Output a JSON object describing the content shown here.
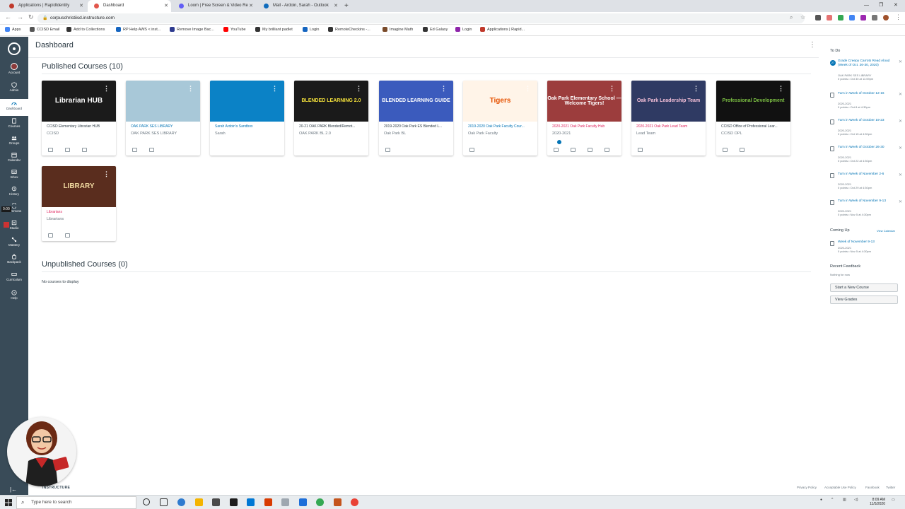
{
  "browser": {
    "tabs": [
      {
        "label": "Applications | RapidIdentity",
        "color": "#c0392b"
      },
      {
        "label": "Dashboard",
        "color": "#e2574c"
      },
      {
        "label": "Loom | Free Screen & Video Re",
        "color": "#625df5"
      },
      {
        "label": "Mail - Ardoin, Sarah - Outlook",
        "color": "#0f6cbd"
      }
    ],
    "new_tab_label": "+",
    "url": "corpuschristiisd.instructure.com",
    "bookmarks": [
      {
        "label": "Apps",
        "color": "#4285f4"
      },
      {
        "label": "CCISD Email",
        "color": "#555555"
      },
      {
        "label": "Add to Collections",
        "color": "#333333"
      },
      {
        "label": "RP Help AWS < inst...",
        "color": "#1565c0"
      },
      {
        "label": "Remove Image Bac...",
        "color": "#2e3b8f"
      },
      {
        "label": "YouTube",
        "color": "#ff0000"
      },
      {
        "label": "My brilliant padlet",
        "color": "#333333"
      },
      {
        "label": "Login",
        "color": "#1565c0"
      },
      {
        "label": "RemoteCheckins -...",
        "color": "#333333"
      },
      {
        "label": "Imagine Math",
        "color": "#7a4b2a"
      },
      {
        "label": "Ed Galaxy",
        "color": "#333333"
      },
      {
        "label": "Login",
        "color": "#8e24aa"
      },
      {
        "label": "Applications | Rapid...",
        "color": "#c0392b"
      }
    ]
  },
  "global_nav": {
    "items": [
      {
        "label": "Account",
        "icon": "avatar"
      },
      {
        "label": "Admin",
        "icon": "shield-icon"
      },
      {
        "label": "Dashboard",
        "icon": "dashboard-icon",
        "active": true
      },
      {
        "label": "Courses",
        "icon": "book-icon"
      },
      {
        "label": "Groups",
        "icon": "groups-icon"
      },
      {
        "label": "Calendar",
        "icon": "calendar-icon"
      },
      {
        "label": "Inbox",
        "icon": "inbox-icon"
      },
      {
        "label": "History",
        "icon": "history-icon"
      },
      {
        "label": "Commons",
        "icon": "commons-icon"
      },
      {
        "label": "Studio",
        "icon": "studio-icon"
      },
      {
        "label": "Mastery",
        "icon": "mastery-icon"
      },
      {
        "label": "Backpack",
        "icon": "backpack-icon"
      },
      {
        "label": "Curriculum",
        "icon": "curriculum-icon"
      },
      {
        "label": "Help",
        "icon": "help-icon"
      }
    ],
    "recording_time": "0:00",
    "collapse_icon": "collapse-icon"
  },
  "dashboard": {
    "title": "Dashboard",
    "published_title": "Published Courses (10)",
    "unpublished_title": "Unpublished Courses (0)",
    "no_courses": "No courses to display",
    "courses": [
      {
        "name": "CCISD Elementary Librarian HUB",
        "code": "CCISD",
        "hero_text": "Librarian HUB",
        "hero_bg": "#1b1b1b",
        "hero_color": "#ffffff",
        "name_color": "#2d3b45",
        "actions": 3
      },
      {
        "name": "OAK PARK SES LIBRARY",
        "code": "OAK PARK SES LIBRARY",
        "hero_text": "",
        "hero_bg": "#a8c8d8",
        "hero_color": "#333333",
        "name_color": "#0374b5",
        "actions": 2
      },
      {
        "name": "Sarah Ardoin's Sandbox",
        "code": "Sarah",
        "hero_text": "",
        "hero_bg": "#0b82c6",
        "hero_color": "#ffffff",
        "name_color": "#0374b5",
        "actions": 0
      },
      {
        "name": "20-21 OAK PARK Blended/Remot...",
        "code": "OAK PARK BL 2.0",
        "hero_text": "BLENDED LEARNING 2.0",
        "hero_bg": "#1a1a1a",
        "hero_color": "#f5e23b",
        "name_color": "#2d3b45",
        "actions": 0
      },
      {
        "name": "2019-2020 Oak Park ES Blended L...",
        "code": "Oak Park BL",
        "hero_text": "BLENDED LEARNING GUIDE",
        "hero_bg": "#3b5bbd",
        "hero_color": "#ffffff",
        "name_color": "#2d3b45",
        "actions": 1
      },
      {
        "name": "2019-2020 Oak Park Faculty Cour...",
        "code": "Oak Park Faculty",
        "hero_text": "Tigers",
        "hero_bg": "#fff4e8",
        "hero_color": "#e65100",
        "name_color": "#0374b5",
        "actions": 1
      },
      {
        "name": "2020-2021 Oak Park Faculty Hub",
        "code": "2020-2021",
        "hero_text": "Oak Park Elementary School — Welcome Tigers!",
        "hero_bg": "#9c3d3d",
        "hero_color": "#ffffff",
        "name_color": "#e0245e",
        "actions": 4,
        "badge": true
      },
      {
        "name": "2020-2021 Oak Park Lead Team",
        "code": "Lead Team",
        "hero_text": "Oak Park Leadership Team",
        "hero_bg": "#2f3a63",
        "hero_color": "#f6c1d9",
        "name_color": "#e0245e",
        "actions": 1
      },
      {
        "name": "CCISD Office of Professional Lear...",
        "code": "CCISD OPL",
        "hero_text": "Professional Development",
        "hero_bg": "#111111",
        "hero_color": "#7cc043",
        "name_color": "#2d3b45",
        "actions": 2
      },
      {
        "name": "Librarians",
        "code": "Librarians",
        "hero_text": "LIBRARY",
        "hero_bg": "#5a2d1e",
        "hero_color": "#f0d9a0",
        "name_color": "#e0245e",
        "actions": 2
      }
    ]
  },
  "sidebar": {
    "todo_title": "To Do",
    "todos": [
      {
        "link": "Grade Creepy Carrots Read Aloud (Week of Oct. 26-30, 2020)",
        "sub": "OAK PARK SES LIBRARY",
        "sub2": "0 points • Oct 30 at 11:59pm",
        "number": "27"
      },
      {
        "link": "Turn in Week of October 12-16",
        "sub": "2020-2021",
        "sub2": "0 points • Oct 8 at 4:30pm"
      },
      {
        "link": "Turn in Week of October 19-23",
        "sub": "2020-2021",
        "sub2": "0 points • Oct 15 at 4:30pm"
      },
      {
        "link": "Turn in Week of October 26-30",
        "sub": "2020-2021",
        "sub2": "0 points • Oct 22 at 4:30pm"
      },
      {
        "link": "Turn in Week of November 2-6",
        "sub": "2020-2021",
        "sub2": "0 points • Oct 29 at 4:30pm"
      },
      {
        "link": "Turn in Week of November 9-13",
        "sub": "2020-2021",
        "sub2": "0 points • Nov 5 at 4:30pm"
      }
    ],
    "coming_up_title": "Coming Up",
    "view_calendar": "View Calendar",
    "coming_up": [
      {
        "link": "Week of November 9-13",
        "sub": "2020-2021",
        "sub2": "0 points • Nov 5 at 4:30pm"
      }
    ],
    "feedback_title": "Recent Feedback",
    "feedback_empty": "Nothing for now",
    "start_course": "Start a New Course",
    "view_grades": "View Grades"
  },
  "footer": {
    "brand": "INSTRUCTURE",
    "links": [
      "Privacy Policy",
      "Acceptable Use Policy",
      "Facebook",
      "Twitter"
    ]
  },
  "taskbar": {
    "search_placeholder": "Type here to search",
    "time": "8:09 AM",
    "date": "11/5/2020",
    "apps": [
      "#1d1d1d",
      "#2e7bcf",
      "#f4b400",
      "#4a4a4a",
      "#0078d4",
      "#d83b01",
      "#9ea7b0",
      "#4f4f4f",
      "#1e6fd9",
      "#34a853",
      "#c4541c",
      "#e94235"
    ]
  }
}
